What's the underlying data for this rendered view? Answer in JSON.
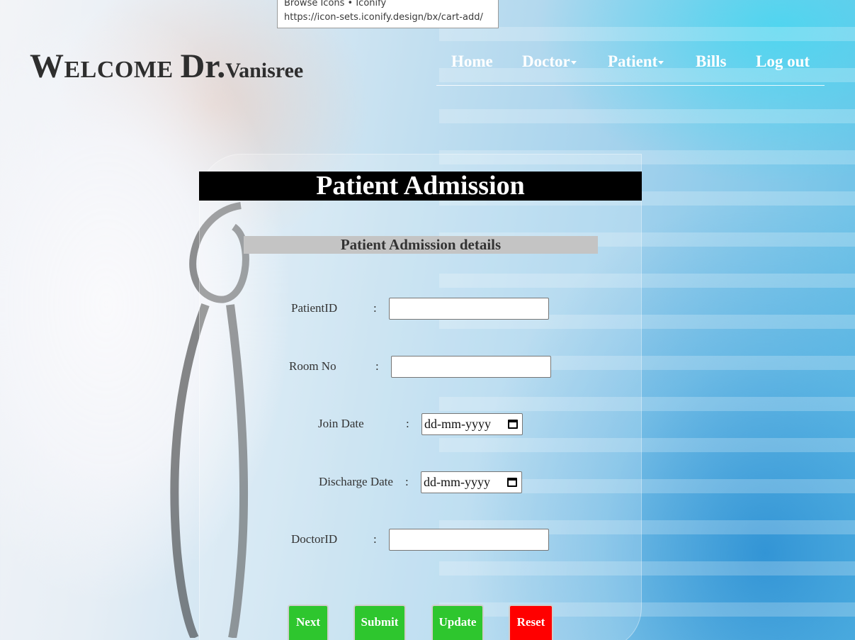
{
  "tooltip": {
    "title": "Browse Icons • Iconify",
    "url": "https://icon-sets.iconify.design/bx/cart-add/"
  },
  "header": {
    "welcome_word": "Welcome",
    "dr_prefix": "Dr.",
    "doctor_name": "Vanisree"
  },
  "nav": {
    "home": "Home",
    "doctor": "Doctor",
    "patient": "Patient",
    "bills": "Bills",
    "logout": "Log out"
  },
  "form": {
    "title": "Patient Admission",
    "section_title": "Patient Admission details",
    "colon": ":",
    "fields": {
      "patient_id": {
        "label": "PatientID",
        "value": ""
      },
      "room_no": {
        "label": "Room No",
        "value": ""
      },
      "join_date": {
        "label": "Join Date",
        "placeholder": "dd-mm-yyyy"
      },
      "discharge_date": {
        "label": "Discharge Date",
        "placeholder": "dd-mm-yyyy"
      },
      "doctor_id": {
        "label": "DoctorID",
        "value": ""
      }
    },
    "buttons": {
      "next": "Next",
      "submit": "Submit",
      "update": "Update",
      "reset": "Reset"
    }
  },
  "colors": {
    "button_green": "#2ec62e",
    "button_red": "#ff0000",
    "title_bar": "#000000",
    "section_bar": "#c4c4c4"
  }
}
